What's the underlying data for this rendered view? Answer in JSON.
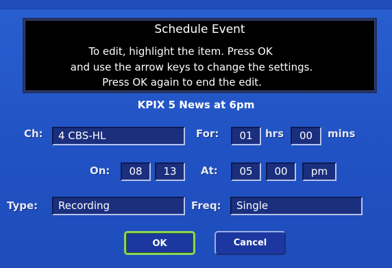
{
  "dialog": {
    "title": "Schedule Event",
    "instructions": [
      "To edit, highlight the item. Press OK",
      "and use the arrow keys to change the settings.",
      "Press OK again to end the edit."
    ],
    "event_name": "KPIX 5 News at 6pm"
  },
  "labels": {
    "ch": "Ch:",
    "for": "For:",
    "hrs": "hrs",
    "mins": "mins",
    "on": "On:",
    "at": "At:",
    "type": "Type:",
    "freq": "Freq:"
  },
  "fields": {
    "channel": "4 CBS-HL",
    "duration_hours": "01",
    "duration_minutes": "00",
    "date_month": "08",
    "date_day": "13",
    "time_hour": "05",
    "time_minute": "00",
    "time_ampm": "pm",
    "type": "Recording",
    "frequency": "Single"
  },
  "buttons": {
    "ok": "OK",
    "cancel": "Cancel"
  },
  "colors": {
    "background": "#2456c8",
    "focus": "#8cd45a",
    "field": "#1b2f7e"
  }
}
